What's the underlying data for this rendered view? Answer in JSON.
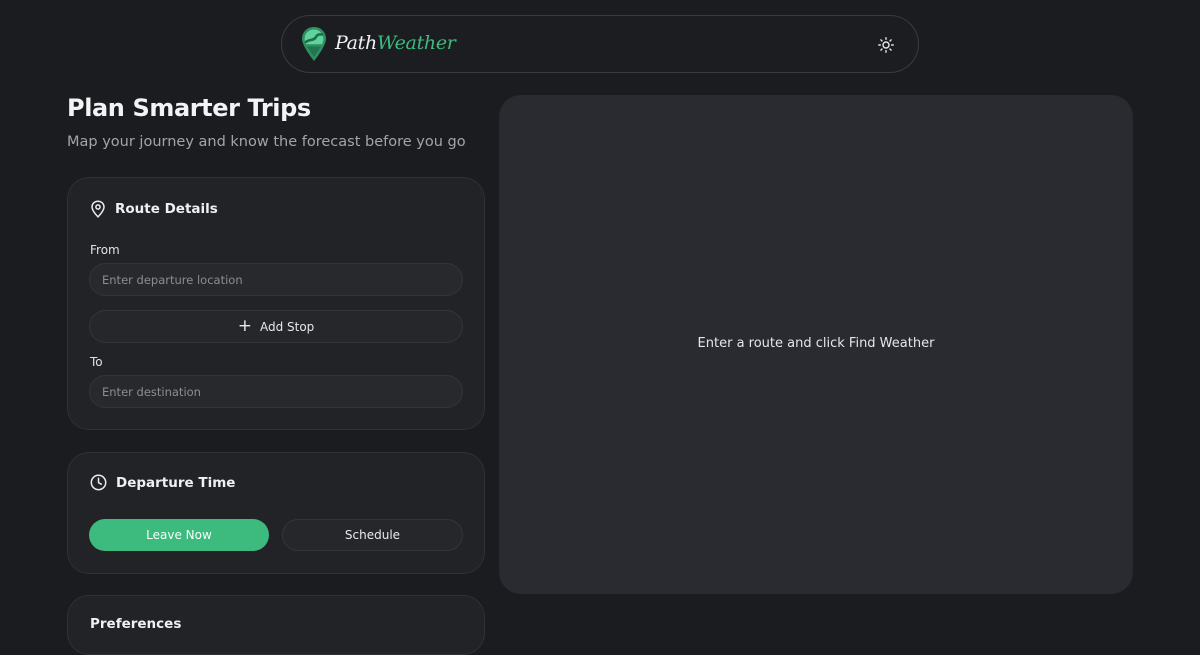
{
  "header": {
    "brand_part1": "Path",
    "brand_part2": "Weather",
    "logo_icon": "map-pin-road-icon",
    "theme_toggle_icon": "sun-icon"
  },
  "hero": {
    "title": "Plan Smarter Trips",
    "subtitle": "Map your journey and know the forecast before you go"
  },
  "route_card": {
    "icon": "location-pin-icon",
    "title": "Route Details",
    "from_label": "From",
    "from_placeholder": "Enter departure location",
    "from_value": "",
    "add_stop_label": "Add Stop",
    "to_label": "To",
    "to_placeholder": "Enter destination",
    "to_value": ""
  },
  "departure_card": {
    "icon": "clock-icon",
    "title": "Departure Time",
    "leave_now_label": "Leave Now",
    "schedule_label": "Schedule",
    "selected": "Leave Now"
  },
  "preferences_card": {
    "title": "Preferences"
  },
  "map": {
    "empty_message": "Enter a route and click Find Weather"
  },
  "colors": {
    "accent": "#3dba7e",
    "background": "#1b1c1f",
    "card": "#222327",
    "map_panel": "#292b31"
  }
}
